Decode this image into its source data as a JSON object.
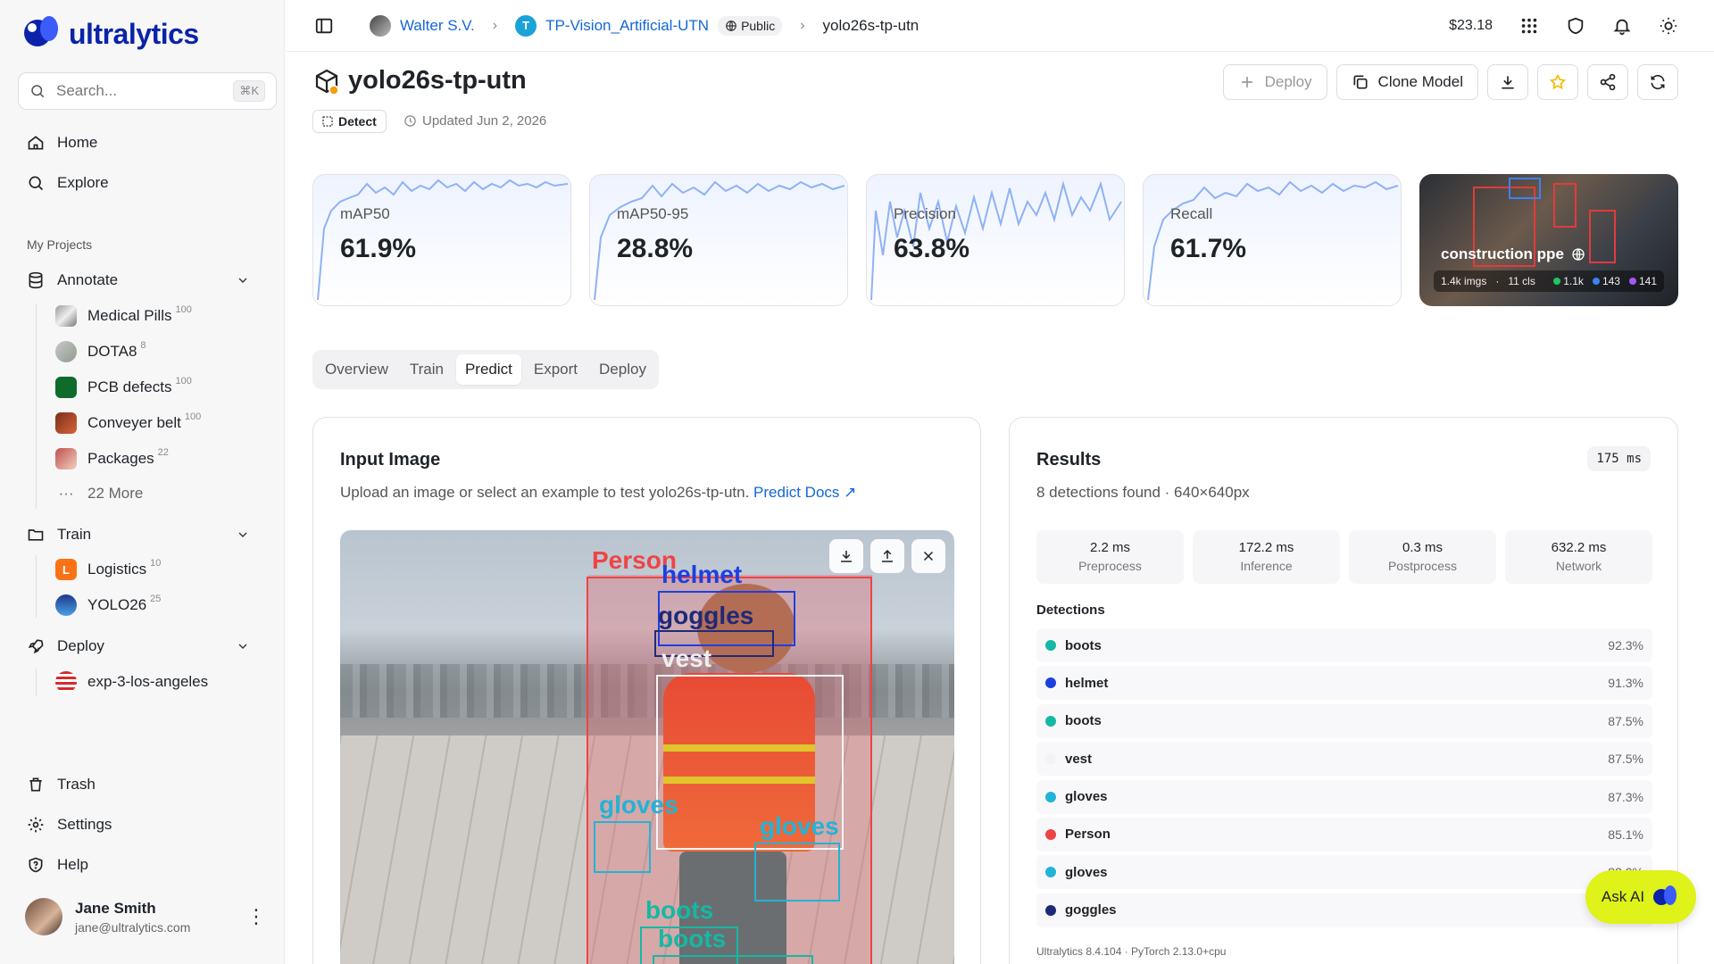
{
  "brand": {
    "name": "ultralytics",
    "color": "#0b23a9"
  },
  "search": {
    "placeholder": "Search...",
    "shortcut": "⌘K"
  },
  "nav": {
    "home": "Home",
    "explore": "Explore"
  },
  "projects_label": "My Projects",
  "annotate": {
    "label": "Annotate",
    "items": [
      {
        "label": "Medical Pills",
        "count": "100"
      },
      {
        "label": "DOTA8",
        "count": "8"
      },
      {
        "label": "PCB defects",
        "count": "100"
      },
      {
        "label": "Conveyer belt",
        "count": "100"
      },
      {
        "label": "Packages",
        "count": "22"
      }
    ],
    "more": "22 More"
  },
  "train": {
    "label": "Train",
    "items": [
      {
        "label": "Logistics",
        "count": "10",
        "badge": "L"
      },
      {
        "label": "YOLO26",
        "count": "25"
      }
    ]
  },
  "deploy": {
    "label": "Deploy",
    "items": [
      {
        "label": "exp-3-los-angeles"
      }
    ]
  },
  "bottom_nav": {
    "trash": "Trash",
    "settings": "Settings",
    "help": "Help"
  },
  "user": {
    "name": "Jane Smith",
    "email": "jane@ultralytics.com"
  },
  "breadcrumb": {
    "user": "Walter S.V.",
    "project_badge": "T",
    "project": "TP-Vision_Artificial-UTN",
    "visibility": "Public",
    "model": "yolo26s-tp-utn"
  },
  "topbar": {
    "credits": "$23.18"
  },
  "model": {
    "title": "yolo26s-tp-utn",
    "task": "Detect",
    "updated": "Updated Jun 2, 2026",
    "actions": {
      "deploy": "Deploy",
      "clone": "Clone Model"
    }
  },
  "metrics": [
    {
      "label": "mAP50",
      "value": "61.9%"
    },
    {
      "label": "mAP50-95",
      "value": "28.8%"
    },
    {
      "label": "Precision",
      "value": "63.8%"
    },
    {
      "label": "Recall",
      "value": "61.7%"
    }
  ],
  "dataset": {
    "name": "construction ppe",
    "images": "1.4k imgs",
    "classes": "11 cls",
    "stat1": "1.1k",
    "stat2": "143",
    "stat3": "141"
  },
  "tabs": [
    "Overview",
    "Train",
    "Predict",
    "Export",
    "Deploy"
  ],
  "active_tab": "Predict",
  "input_panel": {
    "title": "Input Image",
    "subtitle": "Upload an image or select an example to test yolo26s-tp-utn.",
    "docs_link": "Predict Docs ↗",
    "labels": {
      "person": "Person",
      "helmet": "helmet",
      "goggles": "goggles",
      "vest": "vest",
      "gloves1": "gloves",
      "gloves2": "gloves",
      "boots1": "boots",
      "boots2": "boots"
    }
  },
  "results": {
    "title": "Results",
    "latency": "175 ms",
    "summary": "8 detections found · 640×640px",
    "timings": [
      {
        "value": "2.2 ms",
        "label": "Preprocess"
      },
      {
        "value": "172.2 ms",
        "label": "Inference"
      },
      {
        "value": "0.3 ms",
        "label": "Postprocess"
      },
      {
        "value": "632.2 ms",
        "label": "Network"
      }
    ],
    "detections_label": "Detections",
    "detections": [
      {
        "name": "boots",
        "conf": "92.3%",
        "color": "#14b8a6"
      },
      {
        "name": "helmet",
        "conf": "91.3%",
        "color": "#1d3fe0"
      },
      {
        "name": "boots",
        "conf": "87.5%",
        "color": "#14b8a6"
      },
      {
        "name": "vest",
        "conf": "87.5%",
        "color": "#f3f3f5"
      },
      {
        "name": "gloves",
        "conf": "87.3%",
        "color": "#22b3d8"
      },
      {
        "name": "Person",
        "conf": "85.1%",
        "color": "#ef4444"
      },
      {
        "name": "gloves",
        "conf": "82.0%",
        "color": "#22b3d8"
      },
      {
        "name": "goggles",
        "conf": "",
        "color": "#1e2a78"
      }
    ],
    "footer": "Ultralytics 8.4.104 · PyTorch 2.13.0+cpu"
  },
  "ask_ai": "Ask AI"
}
